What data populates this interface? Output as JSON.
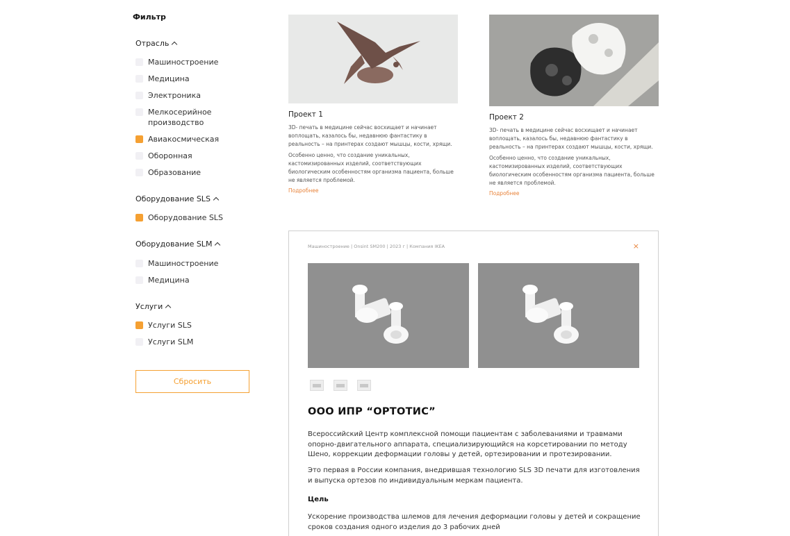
{
  "filter": {
    "title": "Фильтр",
    "groups": [
      {
        "title": "Отрасль",
        "items": [
          {
            "label": "Машиностроение",
            "checked": false
          },
          {
            "label": "Медицина",
            "checked": false
          },
          {
            "label": "Электроника",
            "checked": false
          },
          {
            "label": "Мелкосерийное производство",
            "checked": false
          },
          {
            "label": "Авиакосмическая",
            "checked": true
          },
          {
            "label": "Оборонная",
            "checked": false
          },
          {
            "label": "Образование",
            "checked": false
          }
        ]
      },
      {
        "title": "Оборудование SLS",
        "items": [
          {
            "label": "Оборудование SLS",
            "checked": true
          }
        ]
      },
      {
        "title": "Оборудование SLM",
        "items": [
          {
            "label": "Машиностроение",
            "checked": false
          },
          {
            "label": "Медицина",
            "checked": false
          }
        ]
      },
      {
        "title": "Услуги",
        "items": [
          {
            "label": "Услуги SLS",
            "checked": true
          },
          {
            "label": "Услуги SLM",
            "checked": false
          }
        ]
      }
    ],
    "reset_label": "Сбросить"
  },
  "projects": [
    {
      "title": "Проект 1",
      "text1": "3D- печать в медицине сейчас восхищает и начинает воплощать, казалось бы, недавнюю фантастику в реальность – на принтерах создают мышцы, кости, хрящи.",
      "text2": "Особенно ценно, что создание уникальных, кастомизированных изделий, соответствующих биологическим особенностям организма пациента, больше не является проблемой.",
      "more": "Подробнее"
    },
    {
      "title": "Проект 2",
      "text1": "3D- печать в медицине сейчас восхищает и начинает воплощать, казалось бы, недавнюю фантастику в реальность – на принтерах создают мышцы, кости, хрящи.",
      "text2": "Особенно ценно, что создание уникальных, кастомизированных изделий, соответствующих биологическим особенностям организма пациента, больше не является проблемой.",
      "more": "Подробнее"
    }
  ],
  "detail": {
    "meta": "Машиностроение | Onsint SM200 | 2023 г | Компания IKEA",
    "close": "×",
    "title": "ООО ИПР “ОРТОТИС”",
    "para1": "Всероссийский Центр комплексной помощи пациентам с заболеваниями и травмами опорно-двигательного аппарата, специализирующийся на корсетировании по методу Шено, коррекции деформации головы у детей, ортезировании и протезировании.",
    "para2": "Это первая в России компания, внедрившая технологию SLS 3D печати для изготовления и выпуска ортезов по индивидуальным меркам пациента.",
    "goal_label": "Цель",
    "goal_text": "Ускорение производства шлемов для лечения деформации головы у детей и сокращение сроков создания одного изделия до 3 рабочих дней"
  },
  "colors": {
    "accent": "#f5a032",
    "link": "#e8833a"
  }
}
